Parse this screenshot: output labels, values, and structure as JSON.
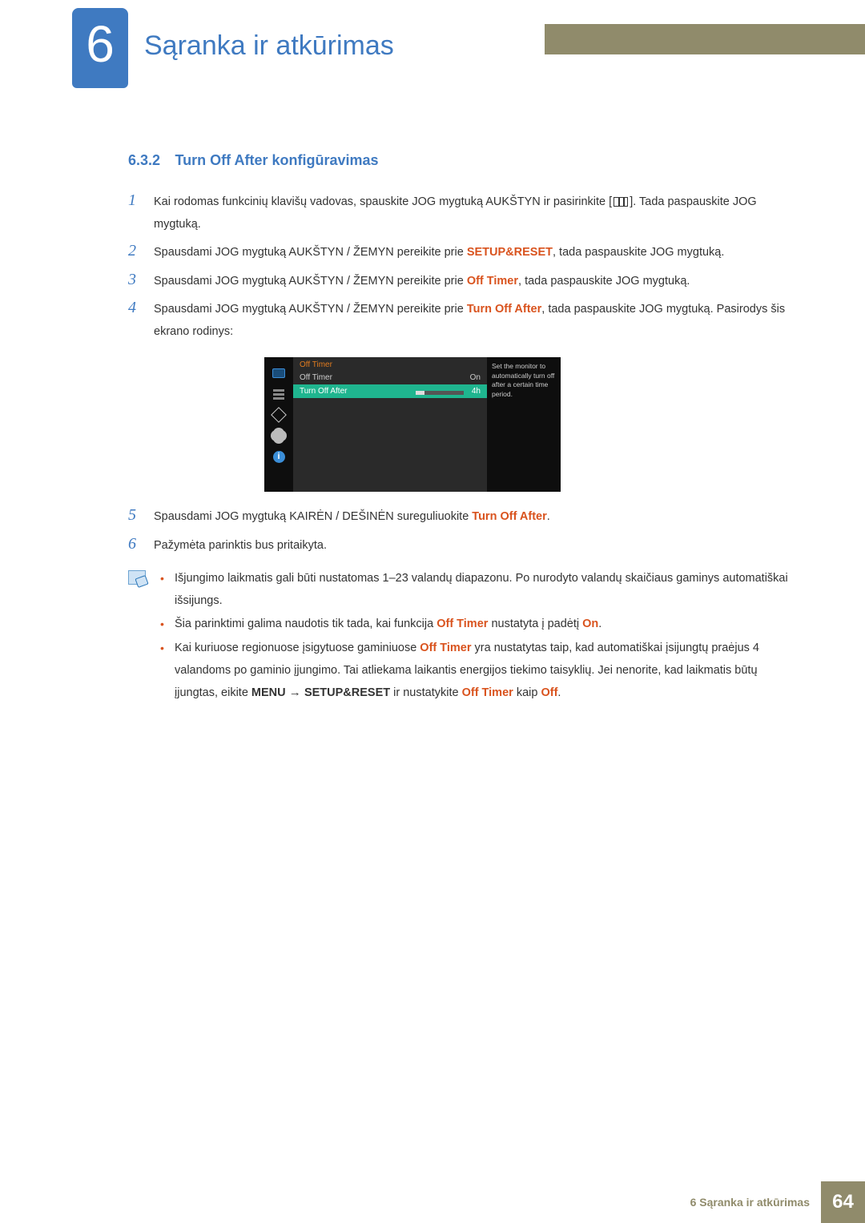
{
  "header": {
    "chapter_number": "6",
    "chapter_title": "Sąranka ir atkūrimas"
  },
  "section": {
    "number": "6.3.2",
    "title": "Turn Off After konfigūravimas"
  },
  "steps": [
    {
      "n": "1",
      "pre": "Kai rodomas funkcinių klavišų vadovas, spauskite JOG mygtuką AUKŠTYN ir pasirinkite [",
      "post": "]. Tada paspauskite JOG mygtuką."
    },
    {
      "n": "2",
      "t1": "Spausdami JOG mygtuką AUKŠTYN / ŽEMYN pereikite prie ",
      "e1": "SETUP&RESET",
      "t2": ", tada paspauskite JOG mygtuką."
    },
    {
      "n": "3",
      "t1": "Spausdami JOG mygtuką AUKŠTYN / ŽEMYN pereikite prie ",
      "e1": "Off Timer",
      "t2": ", tada paspauskite JOG mygtuką."
    },
    {
      "n": "4",
      "t1": "Spausdami JOG mygtuką AUKŠTYN / ŽEMYN pereikite prie ",
      "e1": "Turn Off After",
      "t2": ", tada paspauskite JOG mygtuką. Pasirodys šis ekrano rodinys:"
    },
    {
      "n": "5",
      "t1": "Spausdami JOG mygtuką KAIRĖN / DEŠINĖN sureguliuokite ",
      "e1": "Turn Off After",
      "t2": "."
    },
    {
      "n": "6",
      "t1": "Pažymėta parinktis bus pritaikyta."
    }
  ],
  "osd": {
    "title": "Off Timer",
    "row1_label": "Off Timer",
    "row1_value": "On",
    "row2_label": "Turn Off After",
    "row2_value": "4h",
    "help": "Set the monitor to automatically turn off after a certain time period."
  },
  "notes": [
    {
      "t1": "Išjungimo laikmatis gali būti nustatomas 1–23 valandų diapazonu. Po nurodyto valandų skaičiaus gaminys automatiškai išsijungs."
    },
    {
      "t1": "Šia parinktimi galima naudotis tik tada, kai funkcija ",
      "e1": "Off Timer",
      "t2": " nustatyta į padėtį ",
      "e2": "On",
      "t3": "."
    },
    {
      "t1": "Kai kuriuose regionuose įsigytuose gaminiuose ",
      "e1": "Off Timer",
      "t2": " yra nustatytas taip, kad automatiškai įsijungtų praėjus 4 valandoms po gaminio įjungimo. Tai atliekama laikantis energijos tiekimo taisyklių. Jei nenorite, kad laikmatis būtų įjungtas, eikite ",
      "e2": "MENU",
      "arrow": " → ",
      "e3": "SETUP&RESET",
      "t3": " ir nustatykite ",
      "e4": "Off Timer",
      "t4": " kaip ",
      "e5": "Off",
      "t5": "."
    }
  ],
  "footer": {
    "text": "6 Sąranka ir atkūrimas",
    "page": "64"
  }
}
